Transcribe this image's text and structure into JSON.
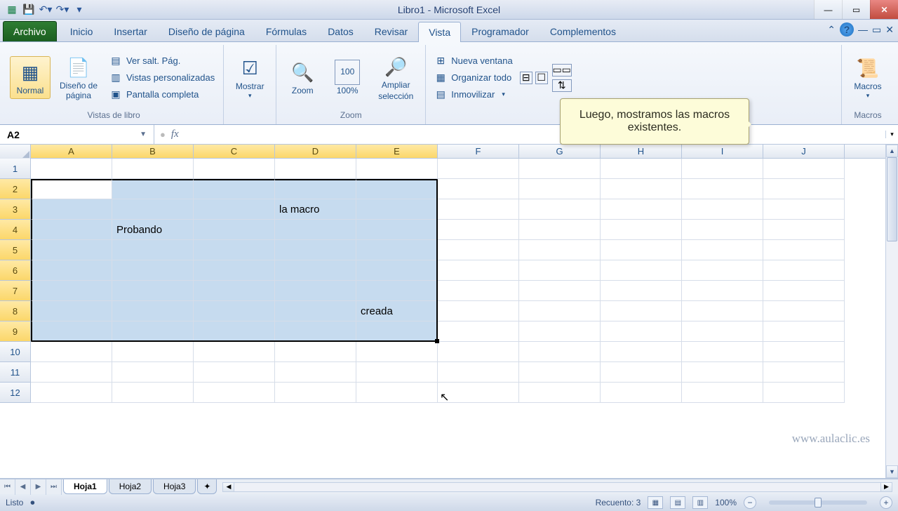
{
  "title": "Libro1 - Microsoft Excel",
  "tabs": [
    "Archivo",
    "Inicio",
    "Insertar",
    "Diseño de página",
    "Fórmulas",
    "Datos",
    "Revisar",
    "Vista",
    "Programador",
    "Complementos"
  ],
  "active_tab": "Vista",
  "ribbon": {
    "views": {
      "normal": "Normal",
      "page_layout": "Diseño de página",
      "page_break": "Ver salt. Pág.",
      "custom_views": "Vistas personalizadas",
      "full_screen": "Pantalla completa",
      "group": "Vistas de libro"
    },
    "show": {
      "label": "Mostrar"
    },
    "zoom": {
      "zoom": "Zoom",
      "hundred": "100%",
      "to_selection_1": "Ampliar",
      "to_selection_2": "selección",
      "group": "Zoom"
    },
    "window": {
      "new": "Nueva ventana",
      "arrange": "Organizar todo",
      "freeze": "Inmovilizar"
    },
    "macros": {
      "label": "Macros",
      "group": "Macros"
    }
  },
  "tooltip": "Luego, mostramos las macros existentes.",
  "name_box": "A2",
  "columns": [
    "A",
    "B",
    "C",
    "D",
    "E",
    "F",
    "G",
    "H",
    "I",
    "J"
  ],
  "selected_cols": [
    "A",
    "B",
    "C",
    "D",
    "E"
  ],
  "rows": [
    1,
    2,
    3,
    4,
    5,
    6,
    7,
    8,
    9,
    10,
    11,
    12
  ],
  "selected_rows": [
    2,
    3,
    4,
    5,
    6,
    7,
    8,
    9
  ],
  "cells": {
    "B4": "Probando",
    "D3": "la macro",
    "E8": "creada"
  },
  "active_cell": "A2",
  "sheets": [
    "Hoja1",
    "Hoja2",
    "Hoja3"
  ],
  "active_sheet": "Hoja1",
  "status": {
    "ready": "Listo",
    "count": "Recuento: 3",
    "zoom": "100%"
  },
  "watermark": "www.aulaclic.es",
  "chart_data": null
}
